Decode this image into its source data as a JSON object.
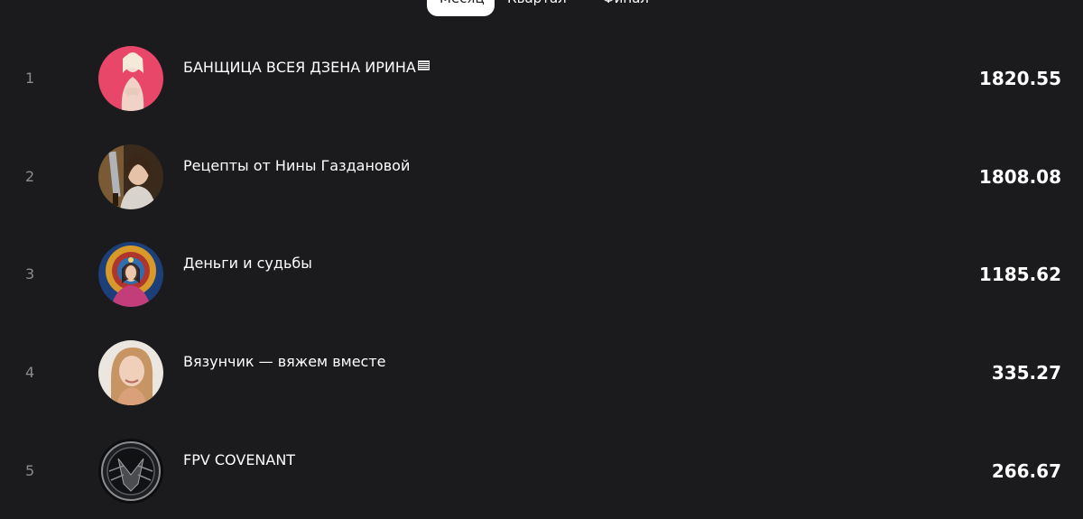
{
  "tabs": [
    {
      "label": "Месяц",
      "active": true
    },
    {
      "label": "Квартал",
      "active": false
    },
    {
      "label": "Финал",
      "active": false
    }
  ],
  "rows": [
    {
      "rank": "1",
      "name": "БАНЩИЦА ВСЕЯ ДЗЕНА ИРИНА",
      "score": "1820.55",
      "avatar": "woman-pink-background"
    },
    {
      "rank": "2",
      "name": "Рецепты от Нины Газдановой",
      "score": "1808.08",
      "avatar": "woman-with-knife"
    },
    {
      "rank": "3",
      "name": "Деньги и судьбы",
      "score": "1185.62",
      "avatar": "ornate-goddess-art"
    },
    {
      "rank": "4",
      "name": "Вязунчик — вяжем вместе",
      "score": "335.27",
      "avatar": "smiling-woman"
    },
    {
      "rank": "5",
      "name": "FPV COVENANT",
      "score": "266.67",
      "avatar": "fpv-covenant-logo"
    }
  ],
  "colors": {
    "background": "#1b1a1d",
    "text": "#ffffff",
    "rank_text": "#8c8b8f",
    "active_tab_bg": "#ffffff"
  }
}
